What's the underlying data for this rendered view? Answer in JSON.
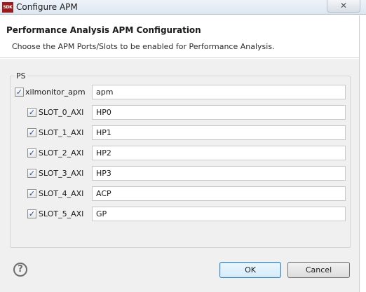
{
  "window": {
    "title": "Configure APM",
    "app_icon_text": "SDK",
    "close_glyph": "✕"
  },
  "header": {
    "title": "Performance Analysis APM Configuration",
    "description": "Choose the APM Ports/Slots to be enabled for Performance Analysis."
  },
  "group": {
    "label": "PS",
    "monitor": {
      "label": "xilmonitor_apm",
      "checked": true,
      "value": "apm"
    },
    "slots": [
      {
        "label": "SLOT_0_AXI",
        "checked": true,
        "value": "HP0"
      },
      {
        "label": "SLOT_1_AXI",
        "checked": true,
        "value": "HP1"
      },
      {
        "label": "SLOT_2_AXI",
        "checked": true,
        "value": "HP2"
      },
      {
        "label": "SLOT_3_AXI",
        "checked": true,
        "value": "HP3"
      },
      {
        "label": "SLOT_4_AXI",
        "checked": true,
        "value": "ACP"
      },
      {
        "label": "SLOT_5_AXI",
        "checked": true,
        "value": "GP"
      }
    ]
  },
  "footer": {
    "help_glyph": "?",
    "ok_label": "OK",
    "cancel_label": "Cancel"
  },
  "check_glyph": "✓",
  "colors": {
    "default_button_border": "#3c7fb1",
    "check_mark": "#2a4f8c",
    "app_icon_bg": "#9a1c1c"
  }
}
